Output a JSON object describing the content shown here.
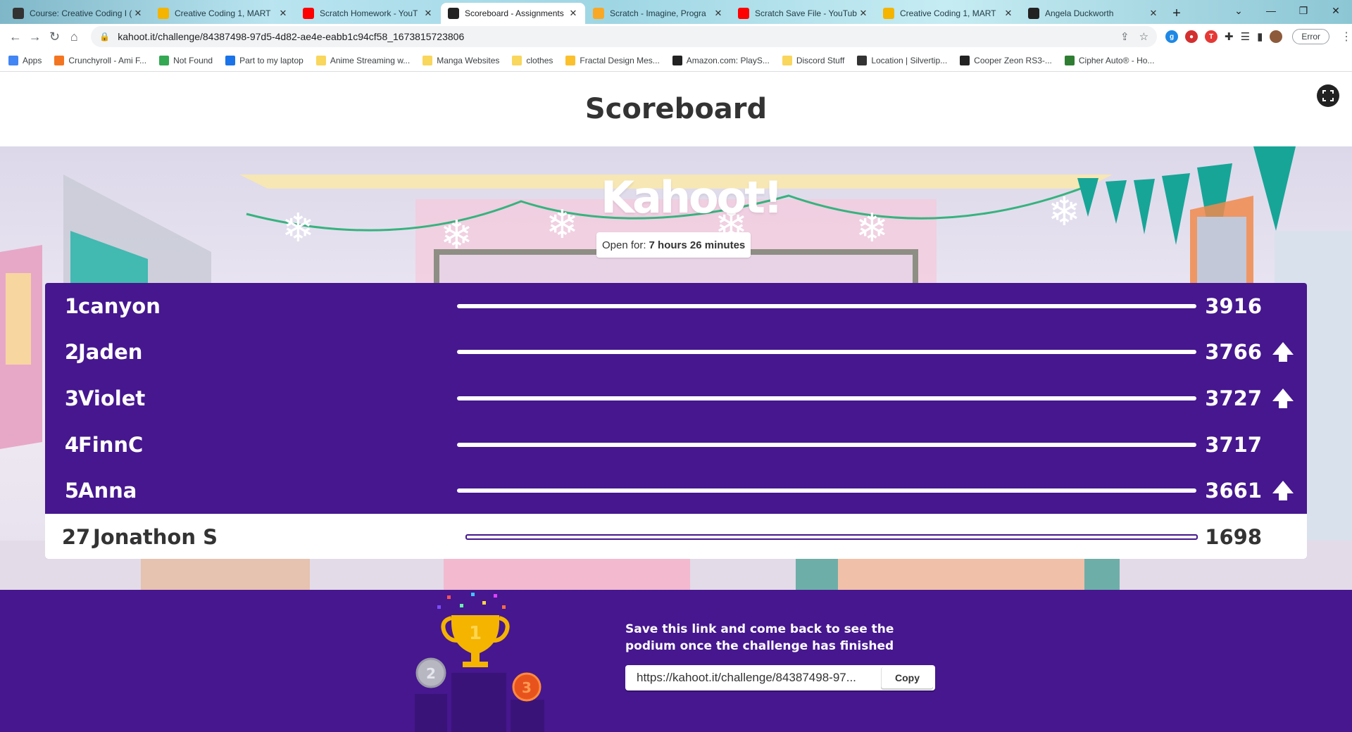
{
  "browser": {
    "tabs": [
      {
        "title": "Course: Creative Coding I (",
        "favicon": "power-icon",
        "color": "#333333"
      },
      {
        "title": "Creative Coding 1, MART",
        "favicon": "drive-icon",
        "color": "#f4b400"
      },
      {
        "title": "Scratch Homework - YouT",
        "favicon": "youtube-icon",
        "color": "#ff0000"
      },
      {
        "title": "Scoreboard - Assignments",
        "favicon": "kahoot-icon",
        "color": "#222222",
        "active": true
      },
      {
        "title": "Scratch - Imagine, Progra",
        "favicon": "scratch-icon",
        "color": "#f9a825"
      },
      {
        "title": "Scratch Save File - YouTub",
        "favicon": "youtube-icon",
        "color": "#ff0000"
      },
      {
        "title": "Creative Coding 1, MART",
        "favicon": "drive-icon",
        "color": "#f4b400"
      },
      {
        "title": "Angela Duckworth",
        "favicon": "ad-icon",
        "color": "#222222"
      }
    ],
    "new_tab": "+",
    "url": "kahoot.it/challenge/84387498-97d5-4d82-ae4e-eabb1c94cf58_1673815723806",
    "error_button": "Error",
    "bookmarks": [
      {
        "label": "Apps",
        "color": "#4285f4"
      },
      {
        "label": "Crunchyroll - Ami F...",
        "color": "#f47521"
      },
      {
        "label": "Not Found",
        "color": "#34a853"
      },
      {
        "label": "Part to my laptop",
        "color": "#1a73e8"
      },
      {
        "label": "Anime Streaming w...",
        "color": "#f9d65c"
      },
      {
        "label": "Manga Websites",
        "color": "#f9d65c"
      },
      {
        "label": "clothes",
        "color": "#f9d65c"
      },
      {
        "label": "Fractal Design Mes...",
        "color": "#fbc02d"
      },
      {
        "label": "Amazon.com: PlayS...",
        "color": "#222222"
      },
      {
        "label": "Discord Stuff",
        "color": "#f9d65c"
      },
      {
        "label": "Location | Silvertip...",
        "color": "#333333"
      },
      {
        "label": "Cooper Zeon RS3-...",
        "color": "#222222"
      },
      {
        "label": "Cipher Auto® - Ho...",
        "color": "#2e7d32"
      }
    ]
  },
  "page": {
    "title": "Scoreboard",
    "logo": "Kahoot!",
    "open_for_label": "Open for:",
    "open_for_value": "7 hours 26 minutes",
    "colors": {
      "purple": "#46178f",
      "white": "#ffffff",
      "dark_text": "#333333"
    }
  },
  "scoreboard": {
    "rows": [
      {
        "rank": "1",
        "name": "canyon",
        "score": "3916",
        "up": false,
        "bar": 1.0
      },
      {
        "rank": "2",
        "name": "Jaden",
        "score": "3766",
        "up": true,
        "bar": 1.0
      },
      {
        "rank": "3",
        "name": "Violet",
        "score": "3727",
        "up": true,
        "bar": 1.0
      },
      {
        "rank": "4",
        "name": "FinnC",
        "score": "3717",
        "up": false,
        "bar": 1.0
      },
      {
        "rank": "5",
        "name": "Anna",
        "score": "3661",
        "up": true,
        "bar": 1.0
      }
    ],
    "me": {
      "rank": "27",
      "name": "Jonathon S",
      "score": "1698",
      "bar": 1.0
    }
  },
  "footer": {
    "save_text": "Save this link and come back to see the podium once the challenge has finished",
    "link": "https://kahoot.it/challenge/84387498-97...",
    "copy_label": "Copy",
    "podium_labels": [
      "1",
      "2",
      "3"
    ]
  }
}
